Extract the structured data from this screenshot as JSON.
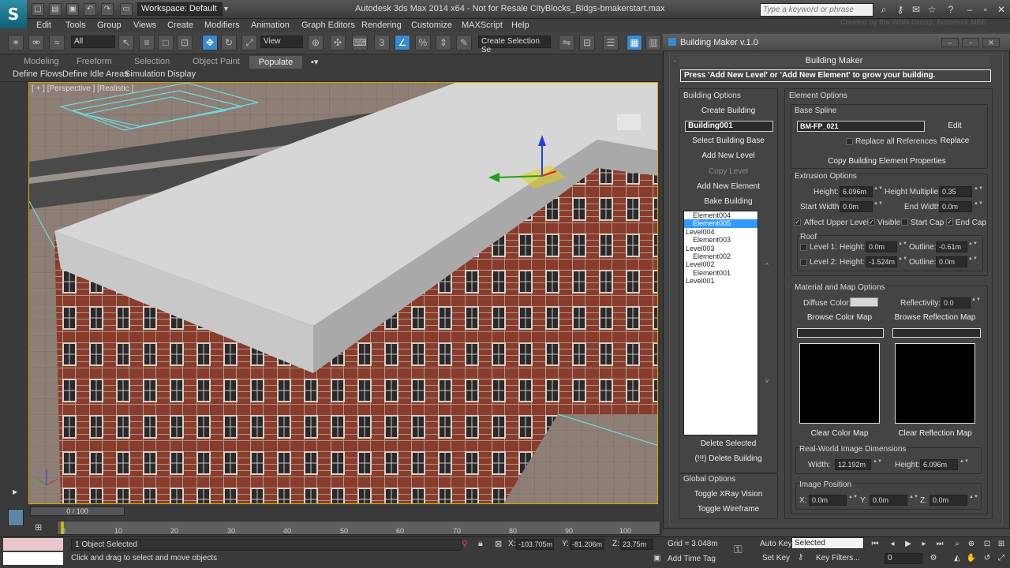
{
  "app": {
    "logo": "S",
    "workspace": "Workspace: Default",
    "title": "Autodesk 3ds Max 2014 x64  -  Not for Resale   CityBlocks_Bldgs-bmakerstart.max",
    "search_placeholder": "Type a keyword or phrase",
    "credit": "Created by the WDM Group, Autodesk MBE"
  },
  "menu": [
    "Edit",
    "Tools",
    "Group",
    "Views",
    "Create",
    "Modifiers",
    "Animation",
    "Graph Editors",
    "Rendering",
    "Customize",
    "MAXScript",
    "Help"
  ],
  "toolbar": {
    "filter": "All",
    "ref_coord": "View",
    "selection_set": "Create Selection Se",
    "number_label": "3"
  },
  "ribbon": {
    "tabs": [
      "Modeling",
      "Freeform",
      "Selection",
      "Object Paint",
      "Populate"
    ],
    "active_tab": "Populate",
    "buttons": [
      "Define Flows",
      "Define Idle Areas",
      "Simulation",
      "Display"
    ]
  },
  "viewport": {
    "label": "[ + ] [Perspective ] [Realistic ]",
    "gizmo_axis": "z"
  },
  "timeline": {
    "slider": "0 / 100",
    "ticks": [
      "0",
      "10",
      "20",
      "30",
      "40",
      "50",
      "60",
      "70",
      "80",
      "90",
      "100"
    ]
  },
  "status": {
    "selection_count": "1 Object Selected",
    "prompt": "Click and drag to select and move objects",
    "x_label": "X:",
    "x_value": "-103.705m",
    "y_label": "Y:",
    "y_value": "-81.206m",
    "z_label": "Z:",
    "z_value": "23.75m",
    "grid": "Grid = 3.048m",
    "add_time_tag": "Add Time Tag",
    "auto_key": "Auto Key",
    "selected": "Selected",
    "set_key": "Set Key",
    "key_filters": "Key Filters...",
    "frame": "0",
    "swatch_colors": [
      "#e8c6cc",
      "#ffffff"
    ]
  },
  "building_maker": {
    "window_title": "Building Maker v.1.0",
    "rollout_title": "Building Maker",
    "instruction": "Press 'Add New Level' or 'Add New Element' to grow your building.",
    "building_options": {
      "label": "Building Options",
      "create_building": "Create Building",
      "building_name": "Building001",
      "select_building_base": "Select Building Base",
      "add_new_level": "Add New Level",
      "copy_level": "Copy Level",
      "add_new_element": "Add New Element",
      "bake_building": "Bake Building",
      "hierarchy": [
        {
          "text": "Element004",
          "indent": true,
          "selected": false
        },
        {
          "text": "Element005",
          "indent": true,
          "selected": true
        },
        {
          "text": "Level004",
          "indent": false,
          "selected": false
        },
        {
          "text": "Element003",
          "indent": true,
          "selected": false
        },
        {
          "text": "Level003",
          "indent": false,
          "selected": false
        },
        {
          "text": "Element002",
          "indent": true,
          "selected": false
        },
        {
          "text": "Level002",
          "indent": false,
          "selected": false
        },
        {
          "text": "Element001",
          "indent": true,
          "selected": false
        },
        {
          "text": "Level001",
          "indent": false,
          "selected": false
        }
      ],
      "scroll_up": "^",
      "scroll_down": "v",
      "delete_selected": "Delete Selected",
      "delete_building": "(!!!) Delete Building"
    },
    "global_options": {
      "label": "Global Options",
      "toggle_xray": "Toggle XRay Vision",
      "toggle_wireframe": "Toggle Wireframe"
    },
    "element_options": {
      "label": "Element Options",
      "base_spline_label": "Base Spline",
      "base_spline": "BM-FP_021",
      "edit": "Edit",
      "replace_all_refs": "Replace all References",
      "replace": "Replace",
      "copy_props": "Copy Building Element Properties"
    },
    "extrusion": {
      "label": "Extrusion Options",
      "height_label": "Height:",
      "height": "6.096m",
      "height_mult_label": "Height Multiplier:",
      "height_mult": "0.35",
      "start_width_label": "Start Width:",
      "start_width": "0.0m",
      "end_width_label": "End Width:",
      "end_width": "0.0m",
      "affect_upper": "Affect Upper Levels",
      "visible": "Visible",
      "start_cap": "Start Cap",
      "end_cap": "End Cap"
    },
    "roof": {
      "label": "Roof",
      "level1_label": "Level 1:",
      "level1_height_label": "Height:",
      "level1_height": "0.0m",
      "level1_outline_label": "Outline:",
      "level1_outline": "-0.61m",
      "level2_label": "Level 2:",
      "level2_height_label": "Height:",
      "level2_height": "-1.524m",
      "level2_outline_label": "Outline:",
      "level2_outline": "0.0m"
    },
    "material": {
      "label": "Material and Map Options",
      "diffuse_label": "Diffuse Color:",
      "diffuse_color": "#d7d7d7",
      "reflectivity_label": "Reflectivity:",
      "reflectivity": "0.0",
      "browse_color": "Browse Color Map",
      "browse_reflection": "Browse Reflection Map",
      "clear_color": "Clear Color Map",
      "clear_reflection": "Clear Reflection Map"
    },
    "real_world": {
      "label": "Real-World Image Dimensions",
      "width_label": "Width:",
      "width": "12.192m",
      "height_label": "Height:",
      "height": "6.096m"
    },
    "image_position": {
      "label": "Image Position",
      "x_label": "X:",
      "x": "0.0m",
      "y_label": "Y:",
      "y": "0.0m",
      "z_label": "Z:",
      "z": "0.0m"
    }
  }
}
